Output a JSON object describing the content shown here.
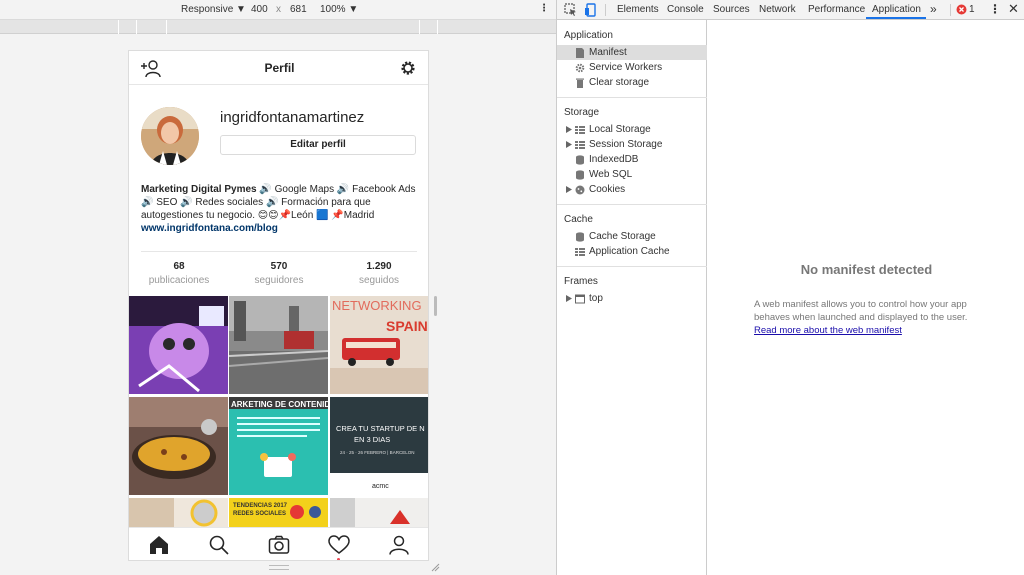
{
  "device_toolbar": {
    "device": "Responsive",
    "width": "400",
    "times": "x",
    "height": "681",
    "zoom": "100%"
  },
  "ig": {
    "title": "Perfil",
    "username": "ingridfontanamartinez",
    "edit_label": "Editar perfil",
    "bio": {
      "name": "Marketing Digital Pymes",
      "text": " 🔊 Google Maps 🔊 Facebook Ads 🔊 SEO 🔊 Redes sociales 🔊 Formación para que autogestiones tu negocio. 😊😊📌León 🟦 📌Madrid",
      "link": "www.ingridfontana.com/blog"
    },
    "stats": [
      {
        "num": "68",
        "label": "publicaciones"
      },
      {
        "num": "570",
        "label": "seguidores"
      },
      {
        "num": "1.290",
        "label": "seguidos"
      }
    ],
    "tiles": {
      "t3": "NETWORKING",
      "t3b": "SPAIN",
      "t5": "ARKETING DE CONTENIDO",
      "t6a": "CREA TU STARTUP DE N",
      "t6b": "EN 3 DIAS",
      "t6c": "24 · 25 · 26 FEBRERO | BARCELON",
      "t6d": "acmc",
      "t7": "TENDENCIAS 2017",
      "t7b": "REDES SOCIALES"
    }
  },
  "devtools": {
    "tabs": [
      "Elements",
      "Console",
      "Sources",
      "Network",
      "Performance",
      "Application"
    ],
    "more": "»",
    "error_count": "1",
    "sections": {
      "application": {
        "title": "Application",
        "items": [
          "Manifest",
          "Service Workers",
          "Clear storage"
        ]
      },
      "storage": {
        "title": "Storage",
        "items": [
          "Local Storage",
          "Session Storage",
          "IndexedDB",
          "Web SQL",
          "Cookies"
        ]
      },
      "cache": {
        "title": "Cache",
        "items": [
          "Cache Storage",
          "Application Cache"
        ]
      },
      "frames": {
        "title": "Frames",
        "items": [
          "top"
        ]
      }
    },
    "main": {
      "heading": "No manifest detected",
      "desc": "A web manifest allows you to control how your app behaves when launched and displayed to the user. ",
      "link": "Read more about the web manifest"
    }
  },
  "colors": {
    "accent": "#1a73e8",
    "error": "#e53935",
    "link": "#1a0dab",
    "ig_link": "#003569"
  }
}
